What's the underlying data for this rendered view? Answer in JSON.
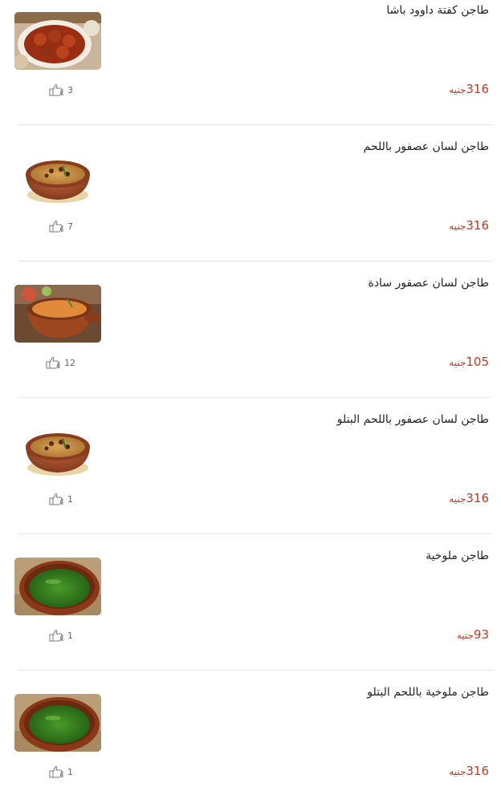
{
  "currency": "جنيه",
  "items": [
    {
      "name": "طاجن كفتة داوود باشا",
      "price": "316",
      "likes": "3",
      "image": "kofta-dish-photo",
      "thumb_style": "photo-square"
    },
    {
      "name": "طاجن لسان عصفور باللحم",
      "price": "316",
      "likes": "7",
      "image": "orzo-meat-clay-pot-photo",
      "thumb_style": "round-pot"
    },
    {
      "name": "طاجن لسان عصفور سادة",
      "price": "105",
      "likes": "12",
      "image": "orzo-plain-clay-pot-photo",
      "thumb_style": "photo-square"
    },
    {
      "name": "طاجن لسان عصفور باللحم البتلو",
      "price": "316",
      "likes": "1",
      "image": "orzo-veal-clay-pot-photo",
      "thumb_style": "round-pot"
    },
    {
      "name": "طاجن ملوخية",
      "price": "93",
      "likes": "1",
      "image": "molokhia-clay-pot-photo",
      "thumb_style": "photo-square"
    },
    {
      "name": "طاجن ملوخية باللحم البتلو",
      "price": "316",
      "likes": "1",
      "image": "molokhia-veal-clay-pot-photo",
      "thumb_style": "photo-square"
    }
  ],
  "colors": {
    "price": "#c8361c",
    "divider": "#e6e6e6"
  }
}
